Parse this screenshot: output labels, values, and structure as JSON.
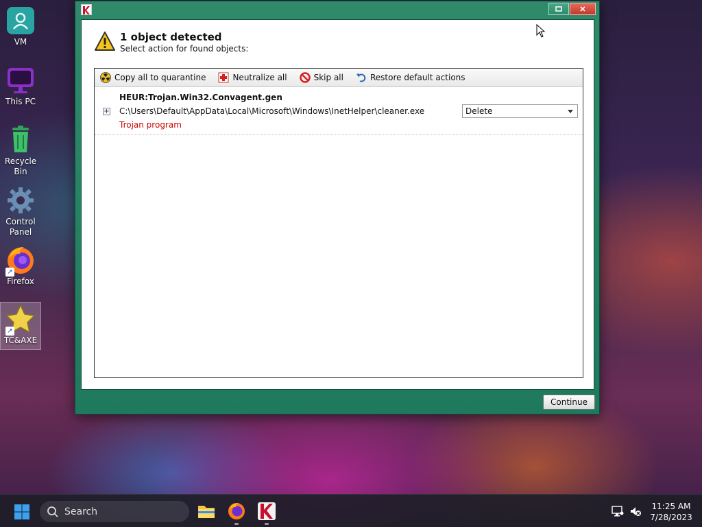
{
  "desktop": {
    "icons": [
      {
        "label": "VM"
      },
      {
        "label": "This PC"
      },
      {
        "label": "Recycle Bin"
      },
      {
        "label": "Control Panel"
      },
      {
        "label": "Firefox"
      },
      {
        "label": "TC&AXE"
      }
    ]
  },
  "window": {
    "heading": "1 object detected",
    "subheading": "Select action for found objects:",
    "toolbar": {
      "copy_quarantine": "Copy all to quarantine",
      "neutralize_all": "Neutralize all",
      "skip_all": "Skip all",
      "restore_defaults": "Restore default actions"
    },
    "objects": [
      {
        "name": "HEUR:Trojan.Win32.Convagent.gen",
        "path": "C:\\Users\\Default\\AppData\\Local\\Microsoft\\Windows\\InetHelper\\cleaner.exe",
        "type": "Trojan program",
        "action": "Delete"
      }
    ],
    "continue_label": "Continue"
  },
  "taskbar": {
    "search_placeholder": "Search",
    "time": "11:25 AM",
    "date": "7/28/2023"
  },
  "colors": {
    "window_frame": "#2f8a6a",
    "threat_type": "#d00000",
    "close_button": "#c0392b"
  }
}
